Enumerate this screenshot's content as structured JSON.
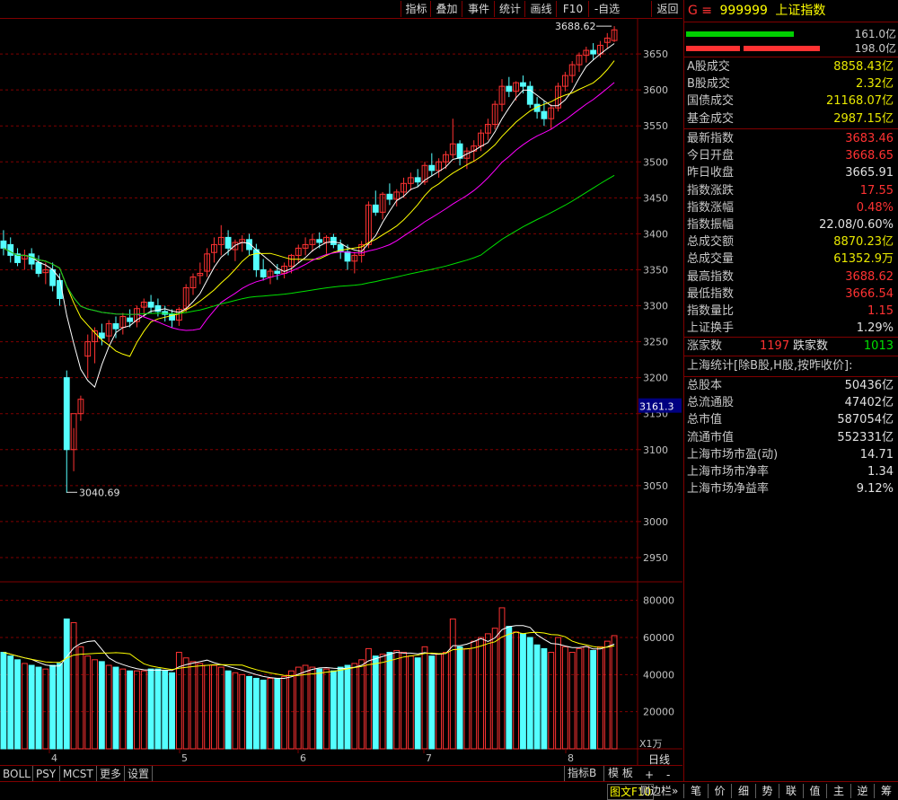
{
  "toolbar": {
    "items": [
      "指标",
      "叠加",
      "事件",
      "统计",
      "画线",
      "F10",
      "-自选",
      "返回"
    ]
  },
  "chart": {
    "high_label": "3688.62",
    "low_label": "3040.69",
    "price_ticks": [
      "3650",
      "3600",
      "3550",
      "3500",
      "3450",
      "3400",
      "3350",
      "3300",
      "3250",
      "3200",
      "3150",
      "3100",
      "3050",
      "3000",
      "2950"
    ],
    "current_price_tag": "3161.3",
    "volume_ticks": [
      "80000",
      "60000",
      "40000",
      "20000"
    ],
    "volume_unit": "X1万",
    "month_labels": [
      "4",
      "5",
      "6",
      "7",
      "8"
    ],
    "period_label": "日线"
  },
  "chart_data": {
    "type": "candlestick",
    "ohlc": [
      [
        3390,
        3405,
        3370,
        3380
      ],
      [
        3385,
        3395,
        3360,
        3370
      ],
      [
        3372,
        3380,
        3355,
        3360
      ],
      [
        3365,
        3378,
        3350,
        3370
      ],
      [
        3372,
        3380,
        3350,
        3358
      ],
      [
        3360,
        3370,
        3340,
        3345
      ],
      [
        3346,
        3360,
        3330,
        3350
      ],
      [
        3350,
        3360,
        3320,
        3328
      ],
      [
        3335,
        3345,
        3300,
        3310
      ],
      [
        3200,
        3210,
        3040,
        3100
      ],
      [
        3100,
        3130,
        3070,
        3150
      ],
      [
        3150,
        3175,
        3140,
        3170
      ],
      [
        3230,
        3260,
        3200,
        3250
      ],
      [
        3250,
        3270,
        3220,
        3265
      ],
      [
        3262,
        3275,
        3245,
        3255
      ],
      [
        3258,
        3280,
        3250,
        3275
      ],
      [
        3275,
        3285,
        3255,
        3268
      ],
      [
        3270,
        3290,
        3260,
        3285
      ],
      [
        3283,
        3295,
        3270,
        3278
      ],
      [
        3278,
        3300,
        3270,
        3296
      ],
      [
        3298,
        3310,
        3285,
        3305
      ],
      [
        3305,
        3315,
        3290,
        3298
      ],
      [
        3300,
        3310,
        3285,
        3292
      ],
      [
        3292,
        3300,
        3278,
        3288
      ],
      [
        3288,
        3295,
        3270,
        3280
      ],
      [
        3280,
        3298,
        3272,
        3295
      ],
      [
        3296,
        3330,
        3290,
        3325
      ],
      [
        3325,
        3345,
        3315,
        3340
      ],
      [
        3342,
        3360,
        3330,
        3345
      ],
      [
        3348,
        3380,
        3340,
        3372
      ],
      [
        3374,
        3395,
        3360,
        3385
      ],
      [
        3385,
        3412,
        3370,
        3395
      ],
      [
        3395,
        3405,
        3370,
        3380
      ],
      [
        3378,
        3392,
        3362,
        3388
      ],
      [
        3388,
        3398,
        3375,
        3392
      ],
      [
        3392,
        3400,
        3370,
        3378
      ],
      [
        3378,
        3386,
        3340,
        3350
      ],
      [
        3350,
        3365,
        3335,
        3340
      ],
      [
        3340,
        3352,
        3330,
        3348
      ],
      [
        3348,
        3358,
        3336,
        3345
      ],
      [
        3345,
        3360,
        3338,
        3355
      ],
      [
        3355,
        3372,
        3345,
        3370
      ],
      [
        3370,
        3385,
        3360,
        3380
      ],
      [
        3380,
        3395,
        3370,
        3385
      ],
      [
        3385,
        3400,
        3375,
        3392
      ],
      [
        3392,
        3402,
        3380,
        3388
      ],
      [
        3388,
        3398,
        3372,
        3395
      ],
      [
        3395,
        3400,
        3380,
        3385
      ],
      [
        3385,
        3392,
        3365,
        3375
      ],
      [
        3375,
        3385,
        3350,
        3362
      ],
      [
        3362,
        3375,
        3345,
        3370
      ],
      [
        3370,
        3390,
        3360,
        3385
      ],
      [
        3385,
        3445,
        3380,
        3440
      ],
      [
        3440,
        3460,
        3425,
        3430
      ],
      [
        3430,
        3458,
        3420,
        3455
      ],
      [
        3455,
        3470,
        3440,
        3448
      ],
      [
        3448,
        3462,
        3438,
        3458
      ],
      [
        3458,
        3478,
        3450,
        3470
      ],
      [
        3470,
        3485,
        3460,
        3478
      ],
      [
        3478,
        3490,
        3465,
        3472
      ],
      [
        3472,
        3500,
        3468,
        3495
      ],
      [
        3495,
        3512,
        3480,
        3488
      ],
      [
        3488,
        3505,
        3478,
        3500
      ],
      [
        3500,
        3515,
        3490,
        3510
      ],
      [
        3510,
        3560,
        3505,
        3525
      ],
      [
        3525,
        3530,
        3495,
        3505
      ],
      [
        3505,
        3520,
        3490,
        3515
      ],
      [
        3515,
        3530,
        3500,
        3522
      ],
      [
        3522,
        3545,
        3515,
        3540
      ],
      [
        3540,
        3560,
        3530,
        3552
      ],
      [
        3552,
        3585,
        3545,
        3580
      ],
      [
        3580,
        3615,
        3570,
        3605
      ],
      [
        3605,
        3618,
        3590,
        3598
      ],
      [
        3598,
        3612,
        3585,
        3610
      ],
      [
        3610,
        3620,
        3595,
        3605
      ],
      [
        3605,
        3612,
        3575,
        3580
      ],
      [
        3580,
        3590,
        3560,
        3570
      ],
      [
        3570,
        3585,
        3550,
        3560
      ],
      [
        3560,
        3580,
        3545,
        3575
      ],
      [
        3575,
        3610,
        3570,
        3605
      ],
      [
        3605,
        3625,
        3598,
        3620
      ],
      [
        3620,
        3640,
        3610,
        3635
      ],
      [
        3635,
        3652,
        3625,
        3648
      ],
      [
        3648,
        3660,
        3638,
        3655
      ],
      [
        3655,
        3665,
        3642,
        3650
      ],
      [
        3650,
        3668,
        3645,
        3662
      ],
      [
        3666,
        3679,
        3658,
        3672
      ],
      [
        3668.65,
        3688.62,
        3666.54,
        3683.46
      ]
    ],
    "price_range": [
      2920,
      3700
    ],
    "volume_range": [
      0,
      90000
    ],
    "volume": [
      52000,
      50000,
      48000,
      46000,
      45000,
      44000,
      43000,
      45000,
      46000,
      70000,
      68000,
      55000,
      50000,
      48000,
      47000,
      45000,
      44000,
      43000,
      42000,
      42000,
      42000,
      43000,
      43000,
      42000,
      41000,
      52000,
      49000,
      47000,
      46000,
      45000,
      45000,
      44000,
      42000,
      41000,
      40000,
      39000,
      38000,
      37000,
      38000,
      38000,
      39000,
      42000,
      44000,
      45000,
      44000,
      43000,
      43000,
      42000,
      44000,
      45000,
      46000,
      48000,
      54000,
      50000,
      51000,
      52000,
      53000,
      52000,
      50000,
      49000,
      55000,
      50000,
      51000,
      52000,
      70000,
      55000,
      54000,
      58000,
      60000,
      62000,
      65000,
      76000,
      66000,
      63000,
      62000,
      60000,
      56000,
      54000,
      52000,
      60000,
      55000,
      52000,
      54000,
      55000,
      53000,
      55000,
      58000,
      61000
    ],
    "ma_series": [
      "MA5",
      "MA10",
      "MA20",
      "MA60"
    ]
  },
  "panel": {
    "header": {
      "prefix": "G ≡",
      "code": "999999",
      "name": "上证指数"
    },
    "bar_values": [
      "161.0亿",
      "198.0亿"
    ],
    "rows1": [
      {
        "k": "A股成交",
        "v": "8858.43亿",
        "c": "yellow"
      },
      {
        "k": "B股成交",
        "v": "2.32亿",
        "c": "yellow"
      },
      {
        "k": "国债成交",
        "v": "21168.07亿",
        "c": "yellow"
      },
      {
        "k": "基金成交",
        "v": "2987.15亿",
        "c": "yellow"
      }
    ],
    "rows2": [
      {
        "k": "最新指数",
        "v": "3683.46",
        "c": "red"
      },
      {
        "k": "今日开盘",
        "v": "3668.65",
        "c": "red"
      },
      {
        "k": "昨日收盘",
        "v": "3665.91",
        "c": "white"
      },
      {
        "k": "指数涨跌",
        "v": "17.55",
        "c": "red"
      },
      {
        "k": "指数涨幅",
        "v": "0.48%",
        "c": "red"
      },
      {
        "k": "指数振幅",
        "v": "22.08/0.60%",
        "c": "white"
      },
      {
        "k": "总成交额",
        "v": "8870.23亿",
        "c": "yellow"
      },
      {
        "k": "总成交量",
        "v": "61352.9万",
        "c": "yellow"
      },
      {
        "k": "最高指数",
        "v": "3688.62",
        "c": "red"
      },
      {
        "k": "最低指数",
        "v": "3666.54",
        "c": "red"
      },
      {
        "k": "指数量比",
        "v": "1.15",
        "c": "red"
      },
      {
        "k": "上证换手",
        "v": "1.29%",
        "c": "white"
      }
    ],
    "updown": {
      "up_label": "涨家数",
      "up_value": "1197",
      "down_label": "跌家数",
      "down_value": "1013"
    },
    "stats_title": "上海统计[除B股,H股,按昨收价]:",
    "rows3": [
      {
        "k": "总股本",
        "v": "50436亿",
        "c": "white"
      },
      {
        "k": "总流通股",
        "v": "47402亿",
        "c": "white"
      },
      {
        "k": "总市值",
        "v": "587054亿",
        "c": "white"
      },
      {
        "k": "流通市值",
        "v": "552331亿",
        "c": "white"
      },
      {
        "k": "上海市场市盈(动)",
        "v": "14.71",
        "c": "white"
      },
      {
        "k": "上海市场市净率",
        "v": "1.34",
        "c": "white"
      },
      {
        "k": "上海市场净益率",
        "v": "9.12%",
        "c": "white"
      }
    ]
  },
  "bottom_tabs": [
    "BOLL",
    "PSY",
    "MCST",
    "更多",
    "设置"
  ],
  "bottom_right": {
    "indicator": "指标B",
    "template": "模 板"
  },
  "status_left": {
    "graph": "图文F10",
    "sidebar": "侧边栏»",
    "plus": "+",
    "minus": "-"
  },
  "status_buttons": [
    "笔",
    "价",
    "细",
    "势",
    "联",
    "值",
    "主",
    "逆",
    "筹"
  ],
  "colors": {
    "up": "#ff3232",
    "down": "#54ffff",
    "grid": "#800000",
    "ma5": "#ffffff",
    "ma10": "#ffff00",
    "ma20": "#ff00ff",
    "ma60": "#00e000"
  }
}
